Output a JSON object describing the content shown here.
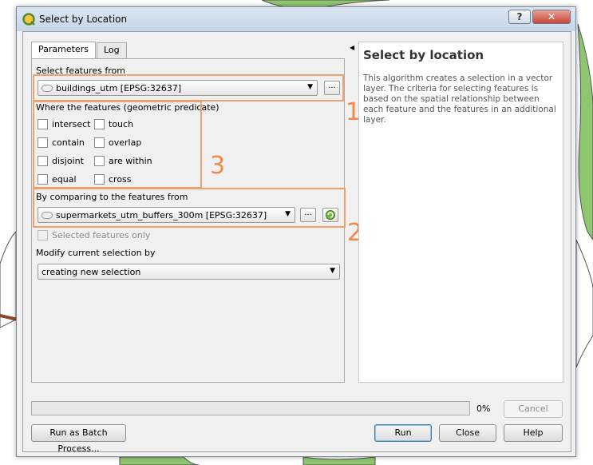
{
  "window": {
    "title": "Select by Location",
    "help_glyph": "?",
    "close_glyph": "✕"
  },
  "tabs": [
    {
      "label": "Parameters",
      "active": true
    },
    {
      "label": "Log",
      "active": false
    }
  ],
  "collapse_glyph": "◀",
  "params": {
    "select_from_label": "Select features from",
    "select_from_value": "buildings_utm [EPSG:32637]",
    "ellipsis": "...",
    "predicate_label": "Where the features (geometric predicate)",
    "predicates": [
      "intersect",
      "touch",
      "contain",
      "overlap",
      "disjoint",
      "are within",
      "equal",
      "cross"
    ],
    "comparing_label": "By comparing to the features from",
    "comparing_value": "supermarkets_utm_buffers_300m [EPSG:32637]",
    "selected_only_label": "Selected features only",
    "modify_label": "Modify current selection by",
    "modify_value": "creating new selection"
  },
  "annotations": {
    "one": "1",
    "two": "2",
    "three": "3",
    "color": "#f08a4b"
  },
  "help": {
    "title": "Select by location",
    "text": "This algorithm creates a selection in a vector layer. The criteria for selecting features is based on the spatial relationship between each feature and the features in an additional layer."
  },
  "footer": {
    "progress_text": "0%",
    "progress": 0,
    "cancel_label": "Cancel",
    "batch_label": "Run as Batch Process...",
    "run_label": "Run",
    "close_label": "Close",
    "help_label": "Help"
  }
}
